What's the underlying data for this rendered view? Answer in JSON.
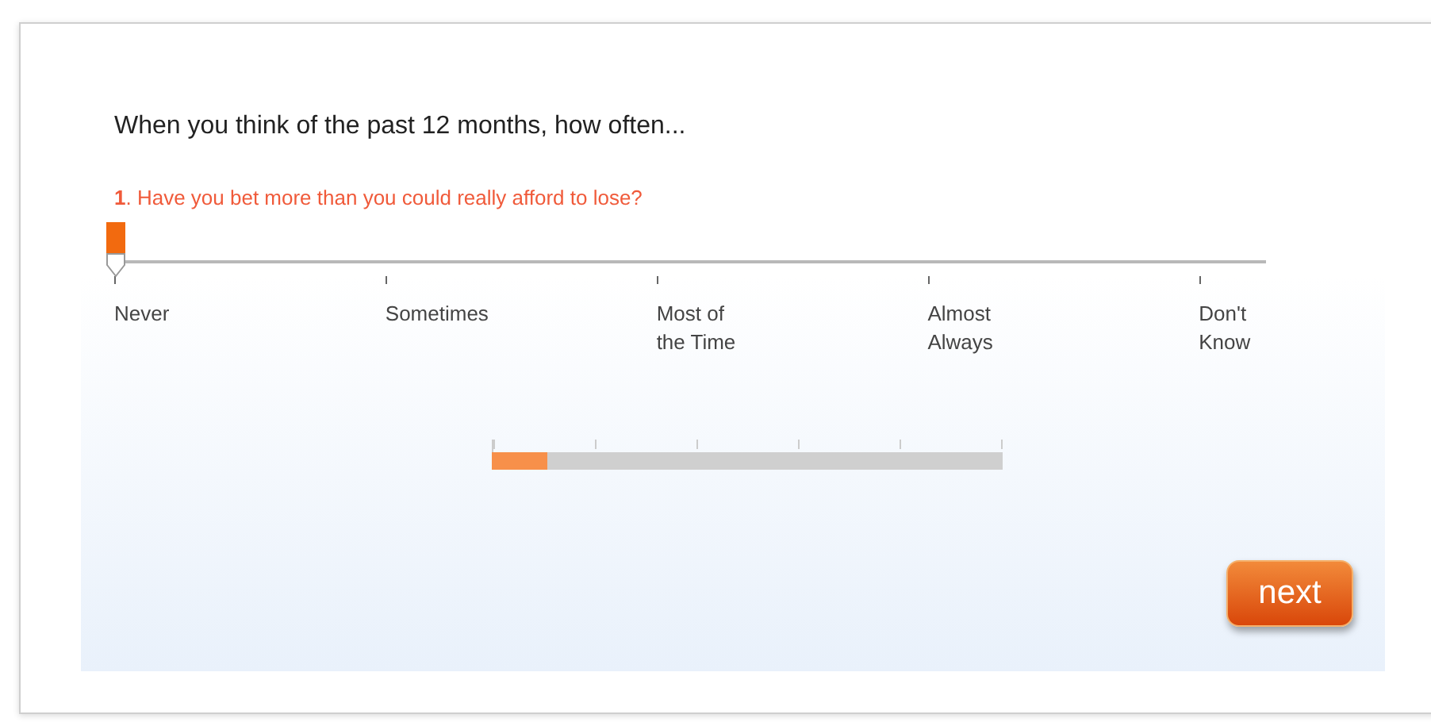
{
  "heading": "When you think of the past 12 months, how often...",
  "question": {
    "text": "**1**. Have you bet more than you could really afford to lose?",
    "level": 0
  },
  "options": [
    "Never",
    "Sometimes",
    "Most of\nthe Time",
    "Almost\nAlways",
    "Don't\nKnow"
  ],
  "progress": {
    "level": 0.11
  },
  "next_button": "next"
}
